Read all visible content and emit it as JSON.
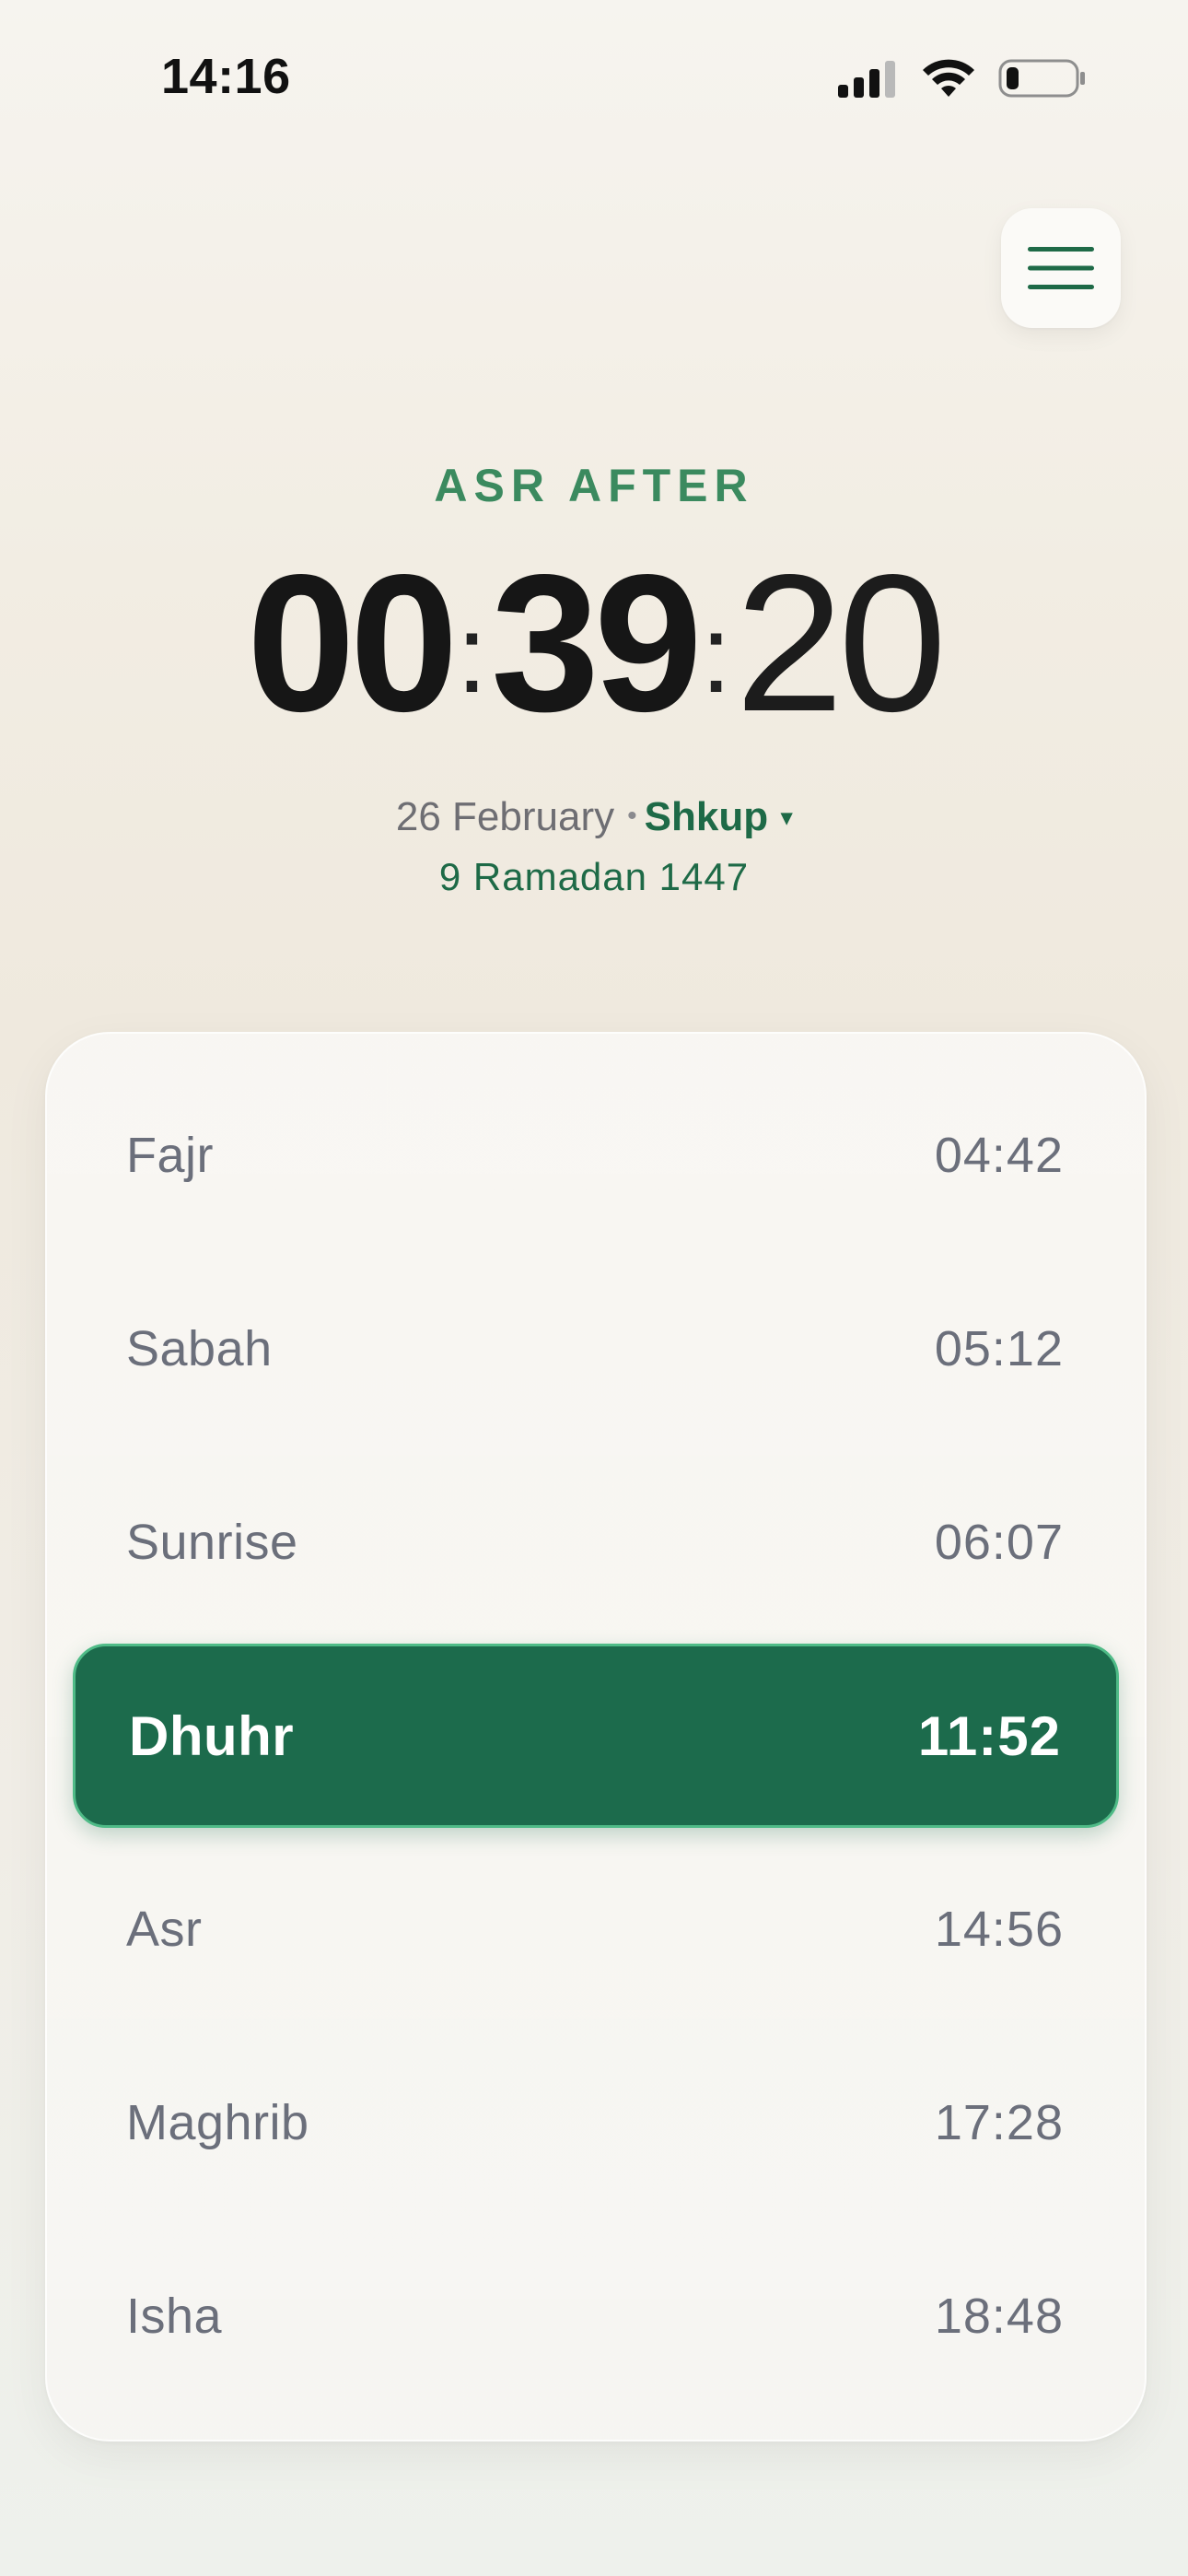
{
  "status_bar": {
    "time": "14:16",
    "icons": [
      "signal-icon",
      "wifi-icon",
      "battery-icon"
    ]
  },
  "menu": {
    "icon": "hamburger-menu-icon"
  },
  "countdown": {
    "label": "ASR AFTER",
    "hours": "00",
    "minutes": "39",
    "seconds": "20",
    "separator": ":"
  },
  "date": {
    "gregorian": "26 February",
    "separator": "•",
    "city": "Shkup",
    "caret": "▾",
    "hijri": "9 Ramadan 1447"
  },
  "prayers": [
    {
      "name": "Fajr",
      "time": "04:42",
      "active": false
    },
    {
      "name": "Sabah",
      "time": "05:12",
      "active": false
    },
    {
      "name": "Sunrise",
      "time": "06:07",
      "active": false
    },
    {
      "name": "Dhuhr",
      "time": "11:52",
      "active": true
    },
    {
      "name": "Asr",
      "time": "14:56",
      "active": false
    },
    {
      "name": "Maghrib",
      "time": "17:28",
      "active": false
    },
    {
      "name": "Isha",
      "time": "18:48",
      "active": false
    }
  ],
  "colors": {
    "accent": "#1c6b4c",
    "accent_border": "#4fbb87",
    "label_green": "#3b8a5f",
    "text_muted": "#6b6f7b"
  }
}
